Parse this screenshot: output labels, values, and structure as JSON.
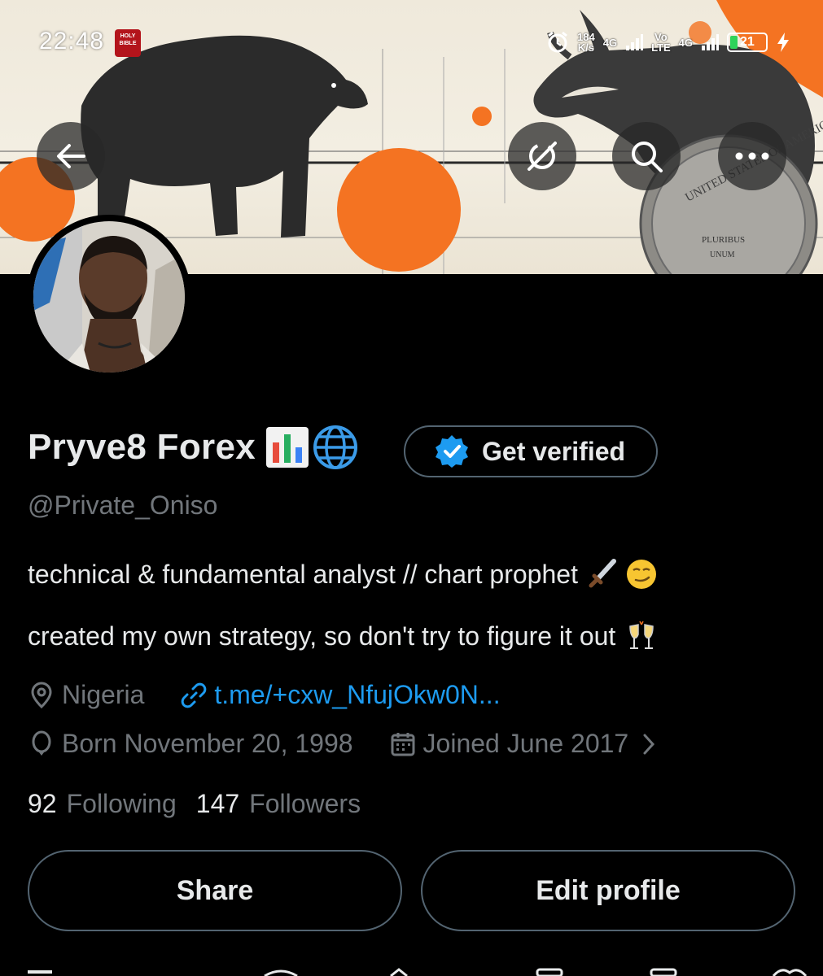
{
  "status_bar": {
    "time": "22:48",
    "bible_icon_text": "HOLY BIBLE",
    "speed_value": "184",
    "speed_unit": "K/s",
    "net1": "4G",
    "volte_top": "Vo",
    "volte_bottom": "LTE",
    "net2": "4G",
    "battery_level": "21"
  },
  "profile": {
    "display_name": "Pryve8 Forex",
    "verify_label": "Get verified",
    "handle": "@Private_Oniso",
    "bio_line1": "technical & fundamental analyst // chart prophet",
    "bio_line2": "created my own strategy, so don't try to figure it out",
    "location": "Nigeria",
    "link": "t.me/+cxw_NfujOkw0N...",
    "birthday": "Born November 20, 1998",
    "joined": "Joined June 2017",
    "following_count": "92",
    "following_label": "Following",
    "followers_count": "147",
    "followers_label": "Followers"
  },
  "actions": {
    "share_label": "Share",
    "edit_label": "Edit profile"
  },
  "banner": {
    "coin_text_1": "UNITED STATES OF AMERICA",
    "coin_text_2": "PLURIBUS",
    "coin_text_3": "UNUM"
  },
  "colors": {
    "background": "#000000",
    "text_primary": "#e7e9ea",
    "text_secondary": "#71767b",
    "link": "#1d9bf0",
    "border": "#536471",
    "banner_orange": "#f47322"
  }
}
